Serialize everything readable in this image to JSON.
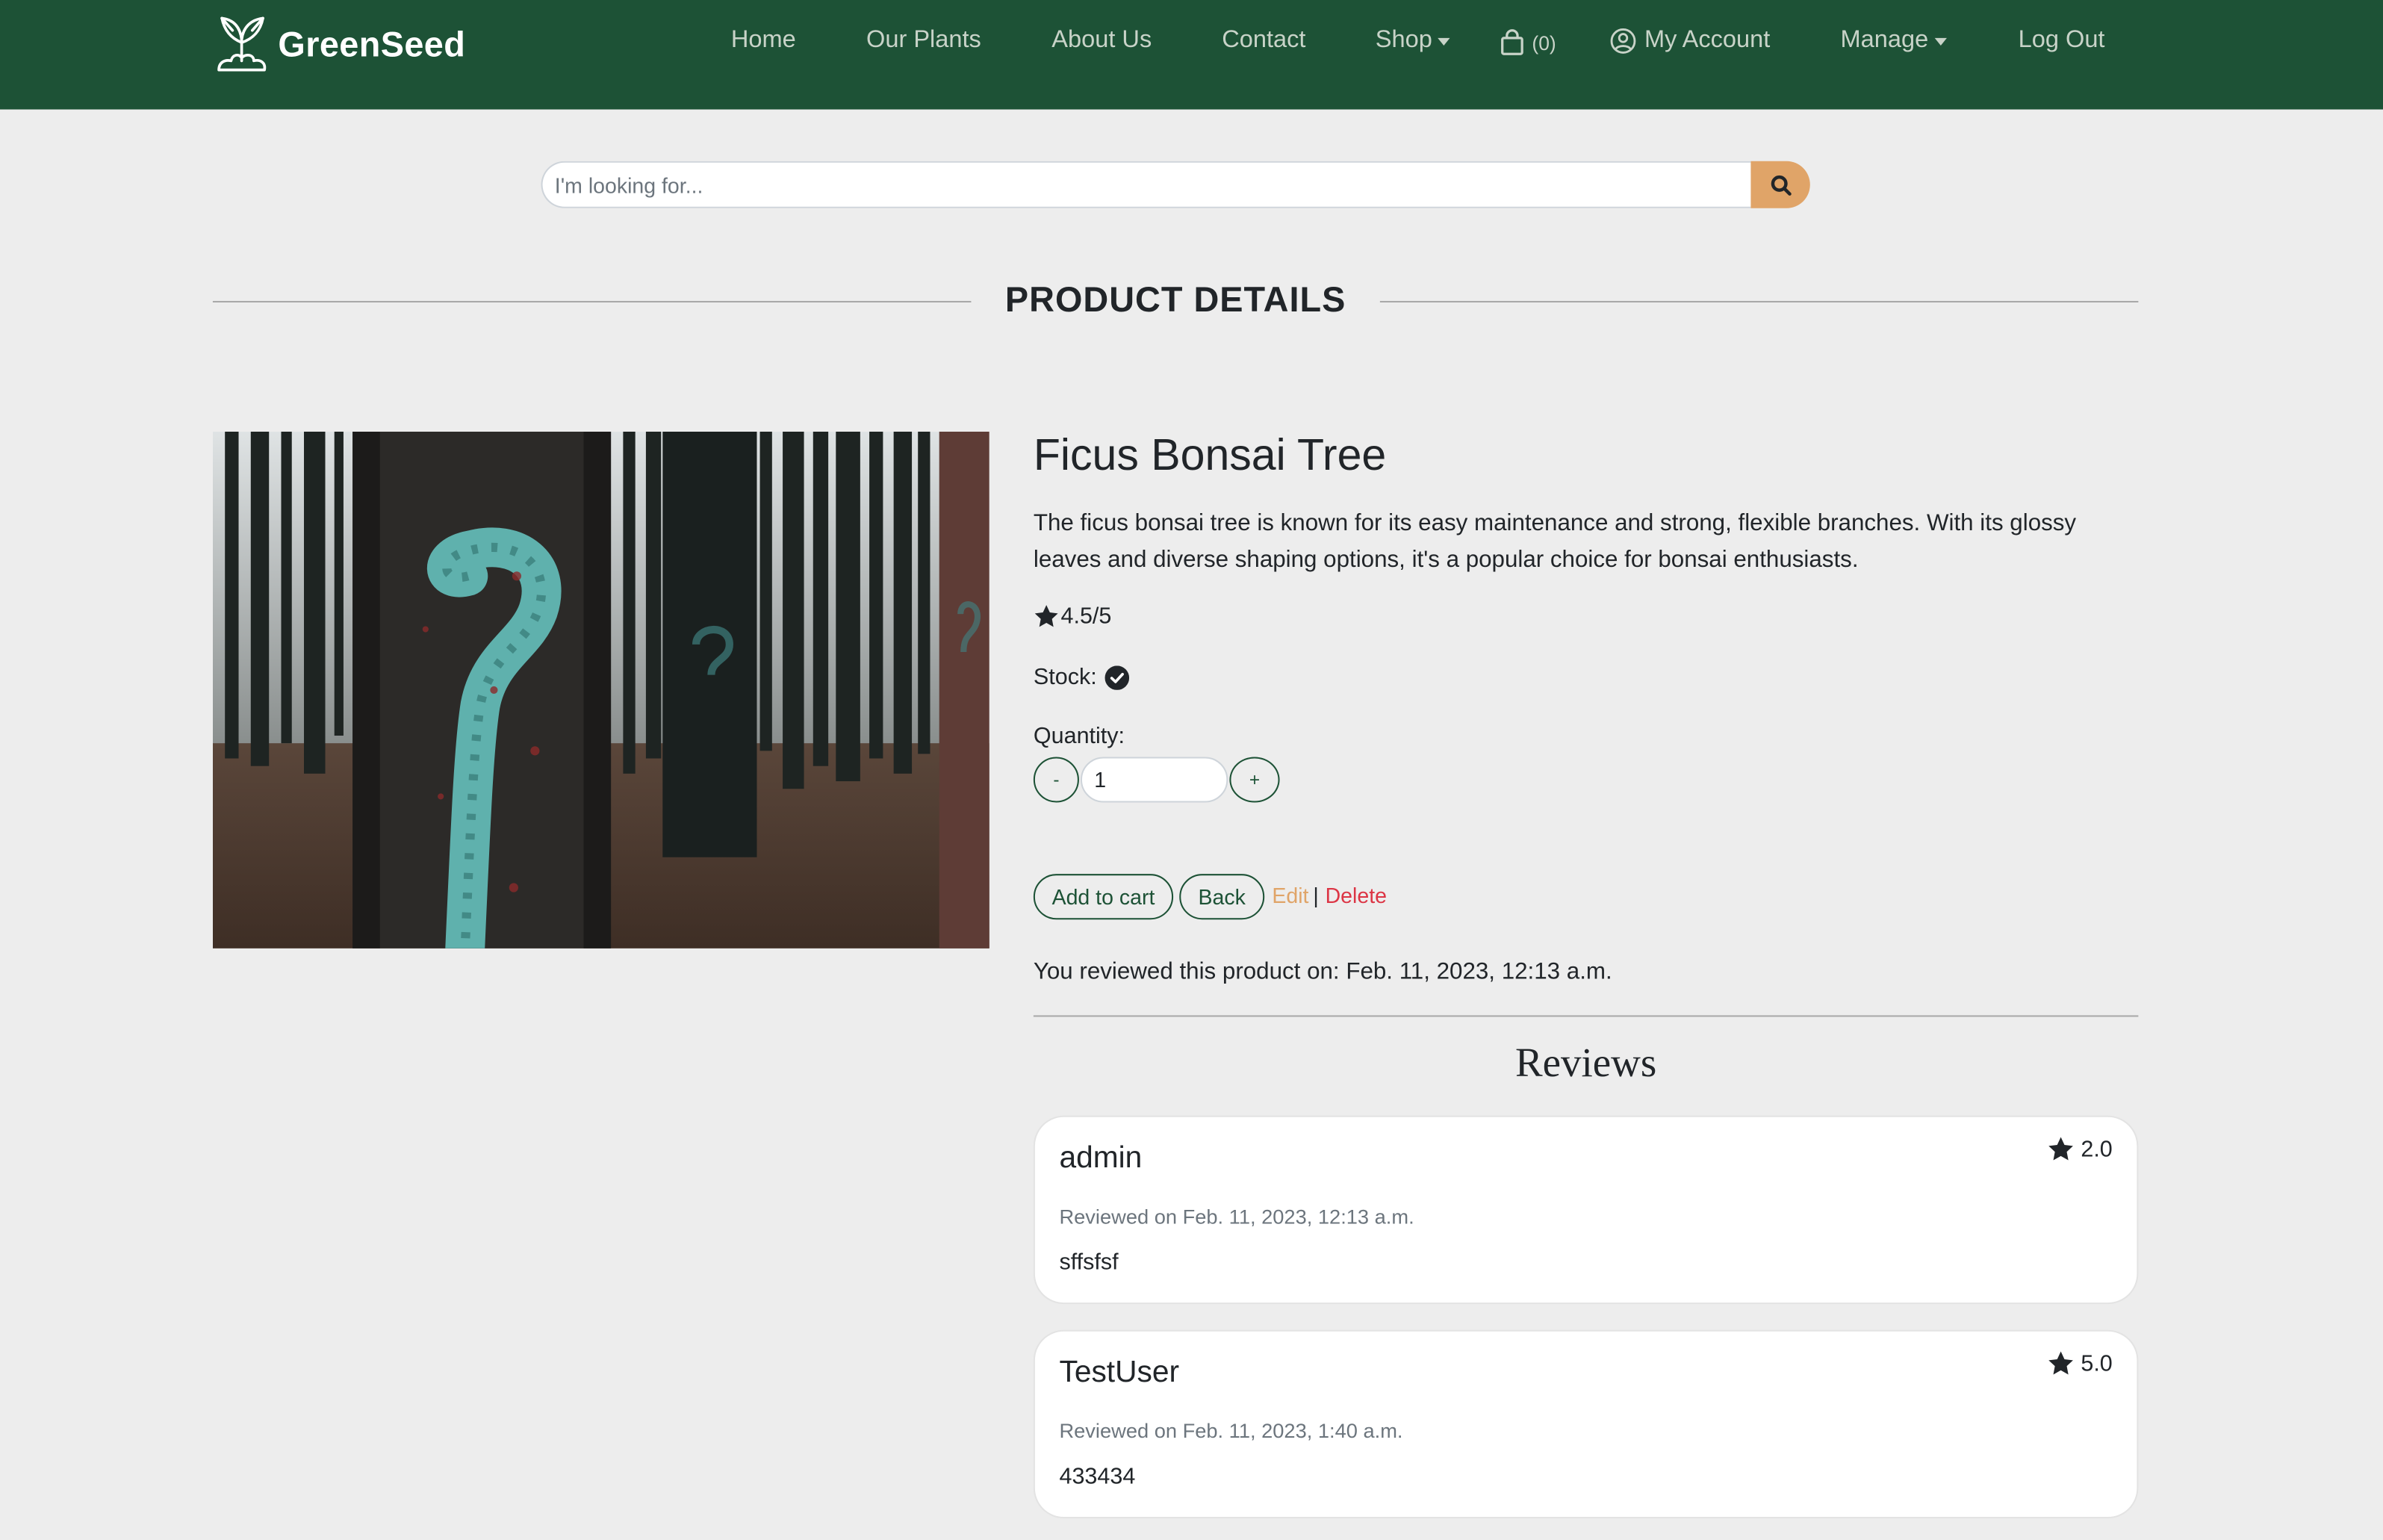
{
  "brand": {
    "name": "GreenSeed"
  },
  "nav": {
    "home": "Home",
    "plants": "Our Plants",
    "about": "About Us",
    "contact": "Contact",
    "shop": "Shop",
    "cart_count": "(0)",
    "account": "My Account",
    "manage": "Manage",
    "logout": "Log Out"
  },
  "search": {
    "placeholder": "I'm looking for..."
  },
  "section_title": "PRODUCT DETAILS",
  "product": {
    "name": "Ficus Bonsai Tree",
    "description": "The ficus bonsai tree is known for its easy maintenance and strong, flexible branches. With its glossy leaves and diverse shaping options, it's a popular choice for bonsai enthusiasts.",
    "rating": "4.5/5",
    "stock_label": "Stock:",
    "quantity_label": "Quantity:",
    "quantity_value": "1",
    "minus_label": "-",
    "plus_label": "+"
  },
  "actions": {
    "add_to_cart": "Add to cart",
    "back": "Back",
    "edit": "Edit",
    "separator": "|",
    "delete": "Delete"
  },
  "reviewed_note": "You reviewed this product on: Feb. 11, 2023, 12:13 a.m.",
  "reviews_heading": "Reviews",
  "reviews": [
    {
      "user": "admin",
      "score": "2.0",
      "date": "Reviewed on Feb. 11, 2023, 12:13 a.m.",
      "text": "sffsfsf"
    },
    {
      "user": "TestUser",
      "score": "5.0",
      "date": "Reviewed on Feb. 11, 2023, 1:40 a.m.",
      "text": "433434"
    }
  ],
  "colors": {
    "navbar": "#1d5236",
    "accent": "#e0a468",
    "danger": "#dc3545",
    "background": "#ededed"
  }
}
